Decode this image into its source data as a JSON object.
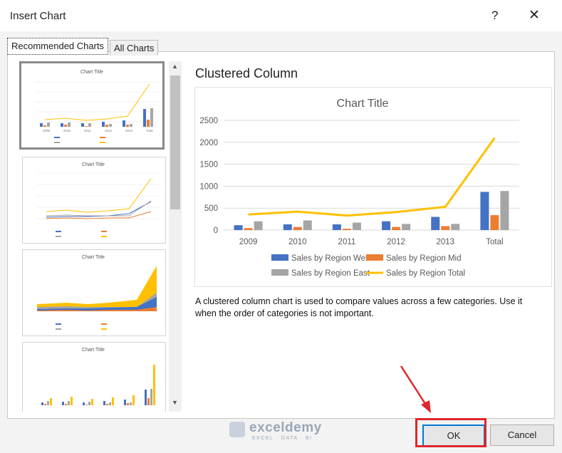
{
  "window": {
    "title": "Insert Chart",
    "help_label": "?",
    "close_label": "✕"
  },
  "tabs": [
    {
      "label": "Recommended Charts"
    },
    {
      "label": "All Charts"
    }
  ],
  "preview": {
    "title": "Clustered Column",
    "description": "A clustered column chart is used to compare values across a few categories. Use it when the order of categories is not important."
  },
  "thumbnails": [
    {
      "title": "Chart Title",
      "kind": "combo"
    },
    {
      "title": "Chart Title",
      "kind": "line"
    },
    {
      "title": "Chart Title",
      "kind": "area"
    },
    {
      "title": "Chart Title",
      "kind": "column"
    }
  ],
  "chart_data": {
    "type": "bar",
    "title": "Chart Title",
    "categories": [
      "2009",
      "2010",
      "2011",
      "2012",
      "2013",
      "Total"
    ],
    "ylim": [
      0,
      2500
    ],
    "yticks": [
      0,
      500,
      1000,
      1500,
      2000,
      2500
    ],
    "series": [
      {
        "name": "Sales by Region West",
        "type": "bar",
        "color": "#4472c4",
        "values": [
          110,
          130,
          130,
          200,
          300,
          870
        ]
      },
      {
        "name": "Sales by Region Mid",
        "type": "bar",
        "color": "#ed7d31",
        "values": [
          45,
          70,
          30,
          70,
          90,
          340
        ]
      },
      {
        "name": "Sales by Region East",
        "type": "bar",
        "color": "#a5a5a5",
        "values": [
          200,
          220,
          170,
          140,
          140,
          890
        ]
      },
      {
        "name": "Sales by Region Total",
        "type": "line",
        "color": "#ffc000",
        "values": [
          355,
          420,
          330,
          410,
          530,
          2100
        ]
      }
    ],
    "legend_position": "bottom",
    "grid": true
  },
  "buttons": {
    "ok": "OK",
    "cancel": "Cancel"
  },
  "watermark": {
    "name": "exceldemy",
    "sub": "EXCEL · DATA · BI"
  },
  "colors": {
    "highlight": "#e0262b",
    "focus": "#0078d7"
  }
}
